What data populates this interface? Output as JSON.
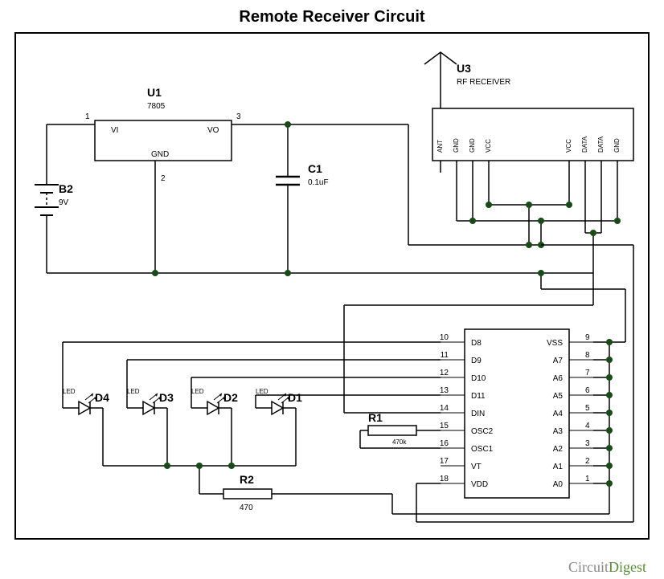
{
  "title": "Remote Receiver Circuit",
  "components": {
    "u1": {
      "ref": "U1",
      "value": "7805",
      "pins": {
        "vi": "VI",
        "vo": "VO",
        "gnd": "GND",
        "n1": "1",
        "n2": "2",
        "n3": "3"
      }
    },
    "u3": {
      "ref": "U3",
      "value": "RF RECEIVER",
      "pins": [
        "ANT",
        "GND",
        "GND",
        "VCC",
        "VCC",
        "DATA",
        "DATA",
        "GND"
      ]
    },
    "b2": {
      "ref": "B2",
      "value": "9V"
    },
    "c1": {
      "ref": "C1",
      "value": "0.1uF"
    },
    "r1": {
      "ref": "R1",
      "value": "470k"
    },
    "r2": {
      "ref": "R2",
      "value": "470"
    },
    "d1": {
      "ref": "D1",
      "type": "LED"
    },
    "d2": {
      "ref": "D2",
      "type": "LED"
    },
    "d3": {
      "ref": "D3",
      "type": "LED"
    },
    "d4": {
      "ref": "D4",
      "type": "LED"
    },
    "decoder": {
      "left_pins": [
        {
          "num": "10",
          "label": "D8"
        },
        {
          "num": "11",
          "label": "D9"
        },
        {
          "num": "12",
          "label": "D10"
        },
        {
          "num": "13",
          "label": "D11"
        },
        {
          "num": "14",
          "label": "DIN"
        },
        {
          "num": "15",
          "label": "OSC2"
        },
        {
          "num": "16",
          "label": "OSC1"
        },
        {
          "num": "17",
          "label": "VT"
        },
        {
          "num": "18",
          "label": "VDD"
        }
      ],
      "right_pins": [
        {
          "num": "9",
          "label": "VSS"
        },
        {
          "num": "8",
          "label": "A7"
        },
        {
          "num": "7",
          "label": "A6"
        },
        {
          "num": "6",
          "label": "A5"
        },
        {
          "num": "5",
          "label": "A4"
        },
        {
          "num": "4",
          "label": "A3"
        },
        {
          "num": "3",
          "label": "A2"
        },
        {
          "num": "2",
          "label": "A1"
        },
        {
          "num": "1",
          "label": "A0"
        }
      ]
    }
  },
  "attribution": {
    "brand1": "Circuit",
    "brand2": "Digest"
  }
}
